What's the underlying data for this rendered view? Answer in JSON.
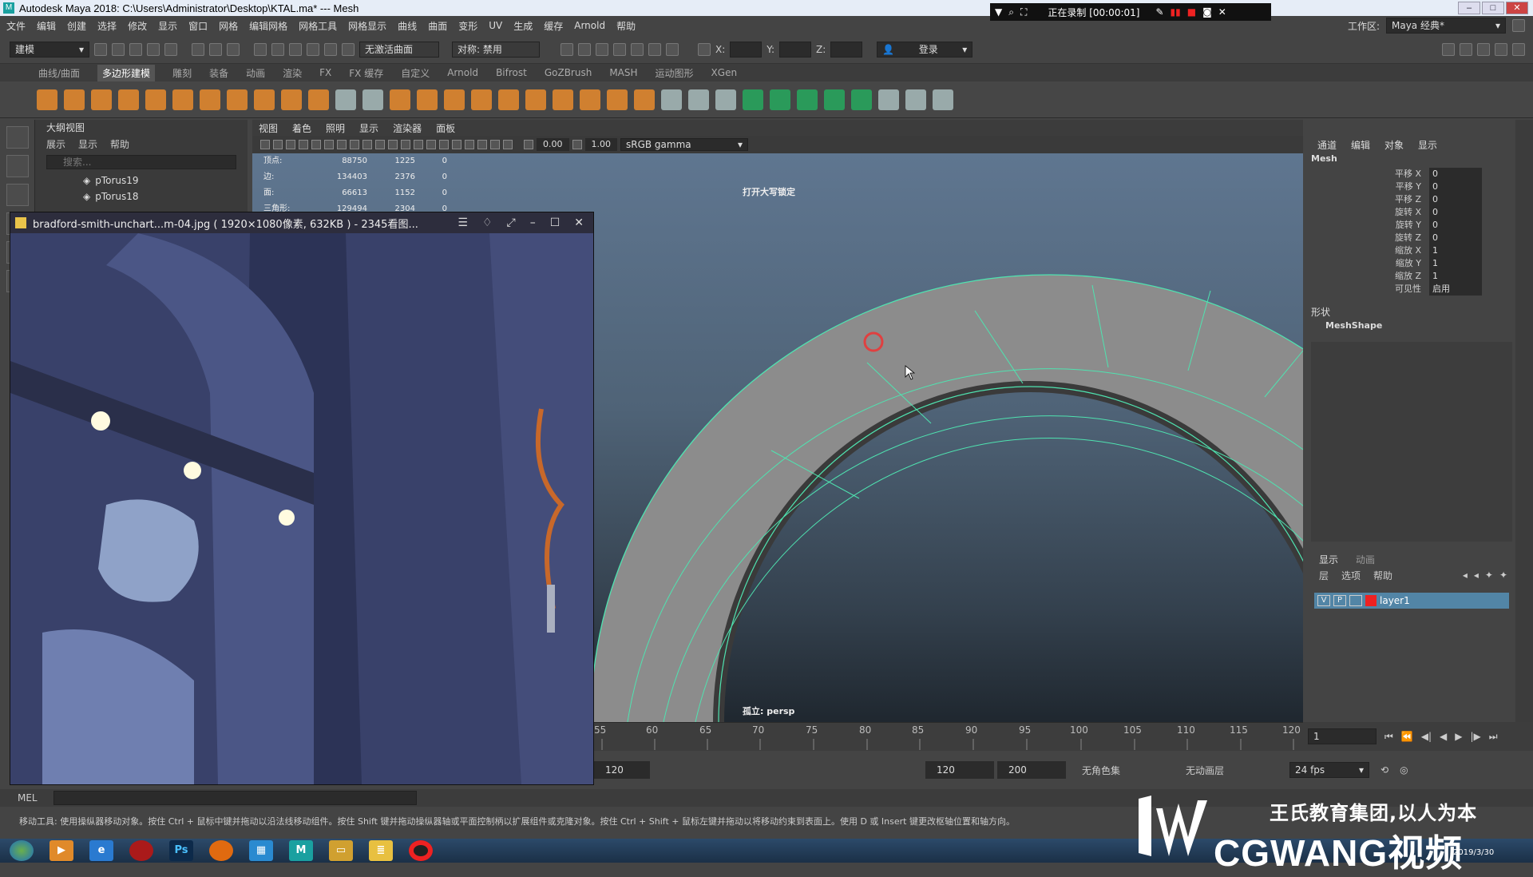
{
  "title_bar": {
    "title": "Autodesk Maya 2018: C:\\Users\\Administrator\\Desktop\\KTAL.ma*   ---   Mesh"
  },
  "recorder": {
    "status": "正在录制 [00:00:01]"
  },
  "menu_bar": {
    "items": [
      "文件",
      "编辑",
      "创建",
      "选择",
      "修改",
      "显示",
      "窗口",
      "网格",
      "编辑网格",
      "网格工具",
      "网格显示",
      "曲线",
      "曲面",
      "变形",
      "UV",
      "生成",
      "缓存",
      "Arnold",
      "帮助"
    ]
  },
  "status_line": {
    "mode": "建模",
    "live_surface": "无激活曲面",
    "symmetry": "对称: 禁用",
    "x_label": "X:",
    "y_label": "Y:",
    "z_label": "Z:",
    "login": "登录",
    "workspace_label": "工作区:",
    "workspace": "Maya 经典*"
  },
  "shelf_tabs": {
    "items": [
      "曲线/曲面",
      "多边形建模",
      "雕刻",
      "装备",
      "动画",
      "渲染",
      "FX",
      "FX 缓存",
      "自定义",
      "Arnold",
      "Bifrost",
      "GoZBrush",
      "MASH",
      "运动图形",
      "XGen"
    ],
    "active": "多边形建模"
  },
  "outliner": {
    "title": "大纲视图",
    "menu": [
      "展示",
      "显示",
      "帮助"
    ],
    "search_placeholder": "搜索...",
    "items": [
      "pTorus19",
      "pTorus18"
    ]
  },
  "viewport": {
    "menu": [
      "视图",
      "着色",
      "照明",
      "显示",
      "渲染器",
      "面板"
    ],
    "exposure": "0.00",
    "gamma": "1.00",
    "color_space": "sRGB gamma",
    "hud": [
      {
        "label": "顶点:",
        "total": "88750",
        "sel": "1225",
        "comp": "0"
      },
      {
        "label": "边:",
        "total": "134403",
        "sel": "2376",
        "comp": "0"
      },
      {
        "label": "面:",
        "total": "66613",
        "sel": "1152",
        "comp": "0"
      },
      {
        "label": "三角形:",
        "total": "129494",
        "sel": "2304",
        "comp": "0"
      }
    ],
    "top_label": "打开大写锁定",
    "camera_label": "孤立: persp"
  },
  "image_viewer": {
    "title": "bradford-smith-unchart...m-04.jpg ( 1920×1080像素, 632KB ) - 2345看图..."
  },
  "channel_box": {
    "menu": [
      "通道",
      "编辑",
      "对象",
      "显示"
    ],
    "object": "Mesh",
    "attrs": [
      {
        "k": "平移 X",
        "v": "0"
      },
      {
        "k": "平移 Y",
        "v": "0"
      },
      {
        "k": "平移 Z",
        "v": "0"
      },
      {
        "k": "旋转 X",
        "v": "0"
      },
      {
        "k": "旋转 Y",
        "v": "0"
      },
      {
        "k": "旋转 Z",
        "v": "0"
      },
      {
        "k": "缩放 X",
        "v": "1"
      },
      {
        "k": "缩放 Y",
        "v": "1"
      },
      {
        "k": "缩放 Z",
        "v": "1"
      },
      {
        "k": "可见性",
        "v": "启用"
      }
    ],
    "shapes_label": "形状",
    "shape_name": "MeshShape"
  },
  "layer_editor": {
    "tabs": [
      "显示",
      "动画"
    ],
    "menu": [
      "层",
      "选项",
      "帮助"
    ],
    "layer": {
      "v": "V",
      "p": "P",
      "name": "layer1",
      "color": "#e02020"
    }
  },
  "time_slider": {
    "ticks": [
      "55",
      "60",
      "65",
      "70",
      "75",
      "80",
      "85",
      "90",
      "95",
      "100",
      "105",
      "110",
      "115",
      "120"
    ],
    "current_frame": "1"
  },
  "range": {
    "start_end": "120",
    "anim_end": "120",
    "max": "200",
    "character_set": "无角色集",
    "anim_layer": "无动画层",
    "fps": "24 fps"
  },
  "mel": {
    "label": "MEL"
  },
  "help_line": {
    "text": "移动工具: 使用操纵器移动对象。按住 Ctrl + 鼠标中键并拖动以沿法线移动组件。按住 Shift 键并拖动操纵器轴或平面控制柄以扩展组件或克隆对象。按住 Ctrl + Shift + 鼠标左键并拖动以将移动约束到表面上。使用 D 或 Insert 键更改枢轴位置和轴方向。"
  },
  "taskbar": {
    "apps": [
      "start",
      "media",
      "ie",
      "rec",
      "ps",
      "firefox",
      "apps",
      "maya",
      "explorer",
      "notepad",
      "obs"
    ],
    "clock": "2019/3/30"
  },
  "watermark": {
    "slogan": "王氏教育集团,以人为本",
    "brand": "CGWANG视频"
  },
  "colors": {
    "viewport_top": "#5f7690",
    "wire": "#4fe3b0",
    "accent_layer": "#5285a6"
  }
}
